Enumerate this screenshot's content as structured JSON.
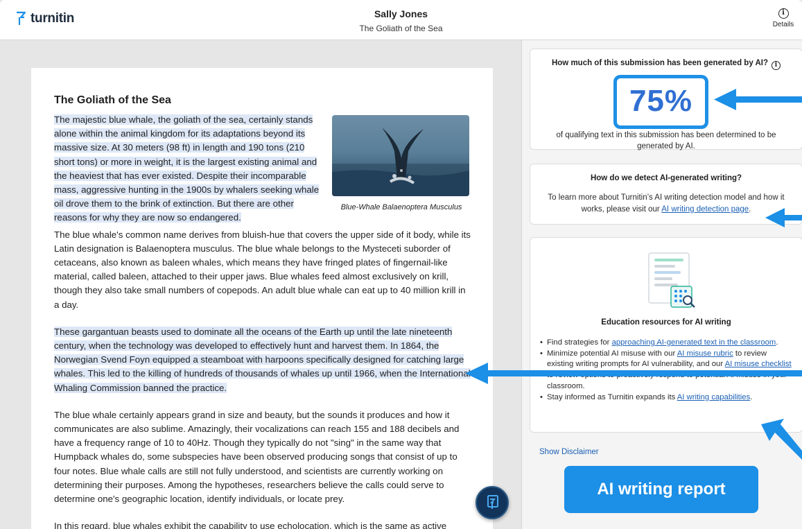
{
  "header": {
    "brand": "turnitin",
    "student_name": "Sally Jones",
    "document_title": "The Goliath of the Sea",
    "details_label": "Details"
  },
  "document": {
    "heading": "The Goliath of the Sea",
    "figure_caption": "Blue-Whale Balaenoptera Musculus",
    "paragraphs": [
      "The majestic blue whale, the goliath of the sea, certainly stands alone within the animal kingdom for its adaptations beyond its massive size. At 30 meters (98 ft) in length and 190 tons (210 short tons) or more in weight, it is the largest existing animal and the heaviest that has ever existed. Despite their incomparable mass, aggressive hunting in the 1900s by whalers seeking whale oil drove them to the brink of extinction. But there are other reasons for why they are now so endangered.",
      "The blue whale's common name derives from bluish-hue that covers the upper side of it body, while its Latin designation is Balaenoptera musculus. The blue whale belongs to the Mysteceti suborder of cetaceans, also known as baleen whales, which means they have fringed plates of fingernail-like material, called baleen, attached to their upper jaws. Blue whales feed almost exclusively on krill, though they also take small numbers of copepods. An adult blue whale can eat up to 40 million krill in a day.",
      "These gargantuan beasts used to dominate all the oceans of the Earth up until the late nineteenth century, when the technology was developed to effectively hunt and harvest them. In 1864, the Norwegian Svend Foyn equipped a steamboat with harpoons specifically designed for catching large whales. This led to the killing of hundreds of thousands of whales up until 1966, when the International Whaling Commission banned the practice.",
      "The blue whale certainly appears grand in size and beauty, but the sounds it produces and how it communicates are also sublime. Amazingly, their vocalizations can reach 155 and 188 decibels and have a frequency range of 10 to 40Hz. Though they typically do not \"sing\" in the same way that Humpback whales do, some subspecies have been observed producing songs that consist of up to four notes. Blue whale calls are still not fully understood, and scientists are currently working on determining their purposes. Among the hypotheses, researchers believe the calls could serve to determine one's geographic location, identify individuals, or locate prey.",
      "In this regard, blue whales exhibit the capability to use echolocation, which is the same as active sonar using sounds made by the animal itself. The identifying of distance and location is done by"
    ]
  },
  "ai_panel": {
    "question": "How much of this submission has been generated by AI?",
    "percentage": "75%",
    "percentage_caption": "of qualifying text in this submission has been determined to be generated by AI.",
    "detect_title": "How do we detect AI-generated writing?",
    "detect_text_before": "To learn more about Turnitin’s AI writing detection model and how it works, please visit our ",
    "detect_link": "AI writing detection page",
    "detect_text_after": ".",
    "edu_title": "Education resources for AI writing",
    "edu_items": [
      {
        "before": "Find strategies for ",
        "link": "approaching AI-generated text in the classroom",
        "after": "."
      },
      {
        "before": "Minimize potential AI misuse with our ",
        "link": "AI misuse rubric",
        "middle": " to review existing writing prompts for AI vulnerability, and our ",
        "link2": "AI misuse checklist",
        "after": " to review options to proactively respond to potential AI misuse in your classroom."
      },
      {
        "before": "Stay informed as Turnitin expands its ",
        "link": "AI writing capabilities",
        "after": "."
      }
    ],
    "show_disclaimer": "Show Disclaimer",
    "report_label": "AI writing report"
  },
  "colors": {
    "accent": "#1c8fe6",
    "percentage_text": "#2f6fd3",
    "highlight": "#dde7f6",
    "link": "#1a5fb4"
  }
}
